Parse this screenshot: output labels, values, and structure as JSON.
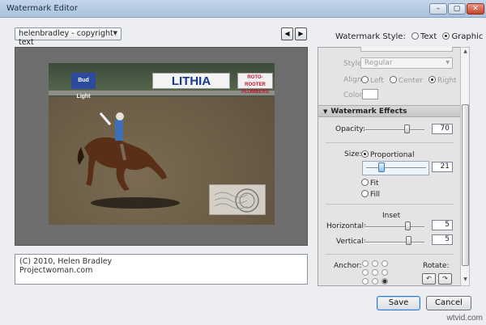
{
  "window": {
    "title": "Watermark Editor",
    "min": "–",
    "max": "▢",
    "close": "✕"
  },
  "preset": {
    "value": "helenbradley - copyright text"
  },
  "nav": {
    "prev": "◀",
    "next": "▶"
  },
  "watermark_style": {
    "label": "Watermark Style:",
    "text": "Text",
    "graphic": "Graphic",
    "selected": "Graphic"
  },
  "preview": {
    "banners": [
      "Bud Light",
      "LITHIA",
      "ROTO-ROOTER PLUMBERS"
    ]
  },
  "caption": {
    "line1": "(C) 2010, Helen Bradley",
    "line2": "Projectwoman.com"
  },
  "text_options": {
    "style_label": "Style:",
    "style_value": "Regular",
    "align_label": "Align:",
    "align_left": "Left",
    "align_center": "Center",
    "align_right": "Right",
    "color_label": "Color:"
  },
  "effects": {
    "title": "Watermark Effects",
    "opacity_label": "Opacity:",
    "opacity_value": "70",
    "opacity_fraction": 0.7,
    "size_label": "Size:",
    "proportional": "Proportional",
    "size_value": "21",
    "size_fraction": 0.21,
    "fit": "Fit",
    "fill": "Fill",
    "inset_label": "Inset",
    "horizontal_label": "Horizontal:",
    "horizontal_value": "5",
    "vertical_label": "Vertical:",
    "vertical_value": "5",
    "anchor_label": "Anchor:",
    "rotate_label": "Rotate:",
    "rotate_ccw": "↶",
    "rotate_cw": "↷"
  },
  "buttons": {
    "save": "Save",
    "cancel": "Cancel"
  },
  "corner_watermark": "wtvid.com",
  "colors": {
    "accent": "#3a7cc5",
    "title_bar": "#b4c9e0"
  }
}
